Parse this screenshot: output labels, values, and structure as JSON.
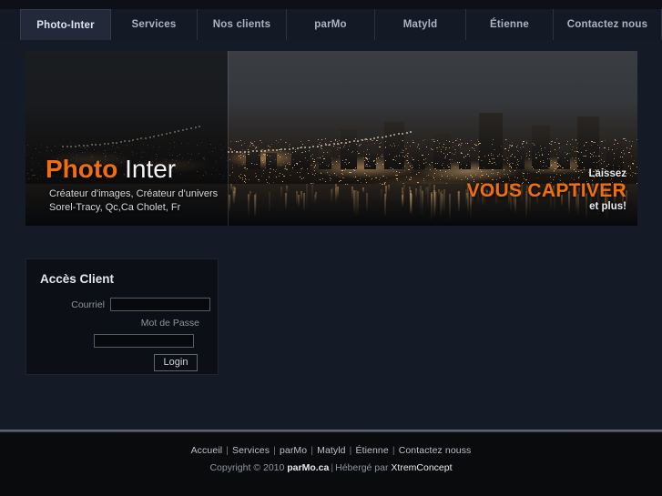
{
  "nav": {
    "tabs": [
      {
        "label": "Photo-Inter",
        "active": true
      },
      {
        "label": "Services",
        "active": false
      },
      {
        "label": "Nos clients",
        "active": false
      },
      {
        "label": "parMo",
        "active": false
      },
      {
        "label": "Matyld",
        "active": false
      },
      {
        "label": "Étienne",
        "active": false
      },
      {
        "label": "Contactez nous",
        "active": false
      }
    ]
  },
  "banner": {
    "logo": {
      "word1": "Photo",
      "word2": " Inter",
      "subtitle1": "Créateur d'images, Créateur d'univers",
      "subtitle2": "Sorel-Tracy, Qc,Ca    Cholet, Fr"
    },
    "tagline": {
      "top": "Laissez",
      "main": "VOUS CAPTIVER",
      "bottom": "et plus!"
    },
    "image_alt": "night cityscape with bridge and water reflections"
  },
  "login": {
    "title": "Accès Client",
    "email_label": "Courriel",
    "email_value": "",
    "email_placeholder": "",
    "password_label": "Mot de Passe",
    "password_value": "",
    "password_placeholder": "",
    "submit_label": "Login"
  },
  "footer": {
    "links": [
      "Accueil",
      "Services",
      "parMo",
      "Matyld",
      "Étienne",
      "Contactez nouss"
    ],
    "separator": "|",
    "copyright_prefix": "Copyright © 2010",
    "brand": "parMo.ca",
    "host_prefix": "Hébergé par",
    "host": "XtremConcept"
  },
  "colors": {
    "accent_orange": "#ef6e12",
    "page_bg": "#151b26",
    "nav_bg": "#141a25",
    "footer_bg": "#0a0b0d",
    "text_light": "#c6ccd8"
  }
}
